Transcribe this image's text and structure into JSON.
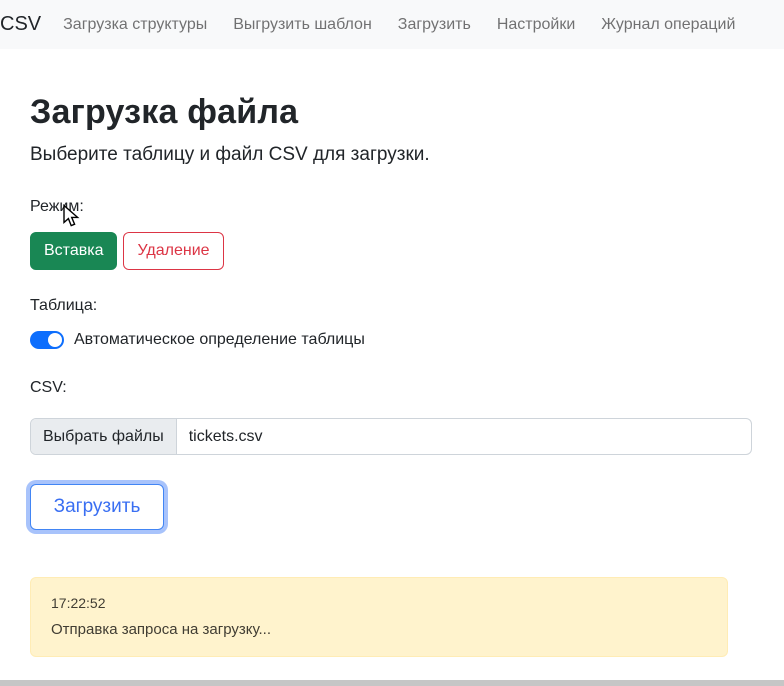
{
  "navbar": {
    "brand": "CSV",
    "items": [
      {
        "label": "Загрузка структуры"
      },
      {
        "label": "Выгрузить шаблон"
      },
      {
        "label": "Загрузить"
      },
      {
        "label": "Настройки"
      },
      {
        "label": "Журнал операций"
      }
    ]
  },
  "page": {
    "title": "Загрузка файла",
    "subtitle": "Выберите таблицу и файл CSV для загрузки."
  },
  "mode": {
    "label": "Режим:",
    "insert_button": "Вставка",
    "delete_button": "Удаление"
  },
  "table": {
    "label": "Таблица:",
    "toggle_state": "on",
    "auto_detect_label": "Автоматическое определение таблицы"
  },
  "csv": {
    "label": "CSV:",
    "choose_files_button": "Выбрать файлы",
    "selected_file": "tickets.csv"
  },
  "upload": {
    "button_label": "Загрузить"
  },
  "log": {
    "timestamp": "17:22:52",
    "message": "Отправка запроса на загрузку..."
  },
  "colors": {
    "navbar_bg": "#f8f9fa",
    "success_green": "#198754",
    "danger_red": "#dc3545",
    "primary_blue": "#0d6efd",
    "focus_ring": "rgba(96,145,248,0.55)",
    "warning_bg": "#fff3cd",
    "warning_border": "#ffecb5"
  }
}
